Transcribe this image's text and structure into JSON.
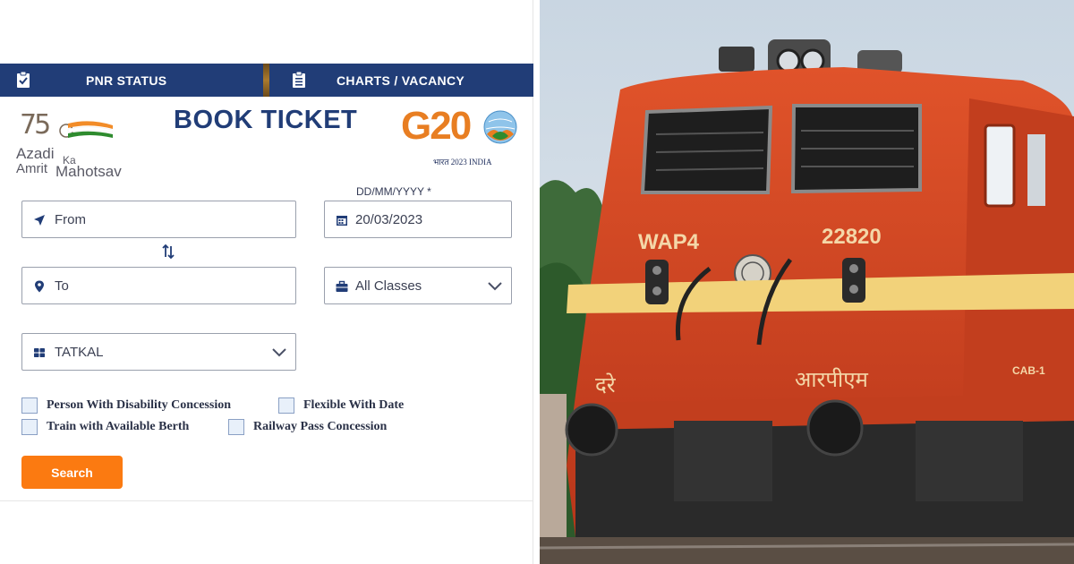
{
  "tabs": [
    {
      "label": "PNR STATUS",
      "icon": "clipboard-check-icon"
    },
    {
      "label": "CHARTS / VACANCY",
      "icon": "chart-list-icon"
    }
  ],
  "logos": {
    "azadi": {
      "number": "75",
      "line1": "Azadi",
      "ka": "Ka",
      "line2": "Amrit",
      "line3": "Mahotsav"
    },
    "g20": {
      "text": "G20",
      "sub": "भारत 2023 INDIA"
    }
  },
  "title": "BOOK TICKET",
  "form": {
    "from": {
      "placeholder": "From",
      "icon": "location-arrow-icon"
    },
    "to": {
      "placeholder": "To",
      "icon": "map-pin-icon"
    },
    "date_label": "DD/MM/YYYY *",
    "date": {
      "value": "20/03/2023",
      "icon": "calendar-icon"
    },
    "classes": {
      "value": "All Classes",
      "icon": "briefcase-icon"
    },
    "quota": {
      "value": "TATKAL",
      "icon": "grid-icon"
    },
    "swap_icon": "swap-vertical-icon"
  },
  "checkboxes": [
    {
      "label": "Person With Disability Concession",
      "checked": false
    },
    {
      "label": "Flexible With Date",
      "checked": false
    },
    {
      "label": "Train with Available Berth",
      "checked": false
    },
    {
      "label": "Railway Pass Concession",
      "checked": false
    }
  ],
  "search_label": "Search",
  "photo": {
    "loco_class": "WAP4",
    "loco_number": "22820",
    "hindi_left": "दरे",
    "hindi_right": "आरपीएम",
    "cab_label": "CAB-1"
  },
  "colors": {
    "tab_bar": "#213d77",
    "title": "#213d77",
    "search_button": "#fb7a11",
    "loco_red": "#d9451c",
    "loco_stripe": "#f2d27a"
  }
}
